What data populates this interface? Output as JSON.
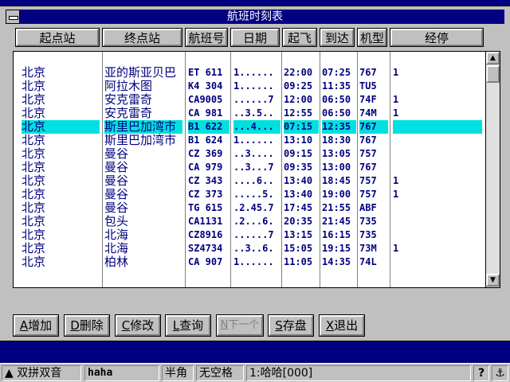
{
  "window": {
    "title": "航班时刻表"
  },
  "columns": [
    "起点站",
    "终点站",
    "航班号",
    "日期",
    "起飞",
    "到达",
    "机型",
    "经停"
  ],
  "rows": [
    {
      "from": "北京",
      "to": "亚的斯亚贝巴",
      "flight": "ET 611",
      "date": "1......",
      "dep": "22:00",
      "arr": "07:25",
      "type": "767",
      "stop": "1"
    },
    {
      "from": "北京",
      "to": "阿拉木图",
      "flight": "K4 304",
      "date": "1......",
      "dep": "09:25",
      "arr": "11:35",
      "type": "TU5",
      "stop": ""
    },
    {
      "from": "北京",
      "to": "安克雷奇",
      "flight": "CA9005",
      "date": "......7",
      "dep": "12:00",
      "arr": "06:50",
      "type": "74F",
      "stop": "1"
    },
    {
      "from": "北京",
      "to": "安克雷奇",
      "flight": "CA 981",
      "date": "..3.5..",
      "dep": "12:55",
      "arr": "06:50",
      "type": "74M",
      "stop": "1"
    },
    {
      "from": "北京",
      "to": "斯里巴加湾市",
      "flight": "B1 622",
      "date": "...4...",
      "dep": "07:15",
      "arr": "12:35",
      "type": "767",
      "stop": ""
    },
    {
      "from": "北京",
      "to": "斯里巴加湾市",
      "flight": "B1 624",
      "date": "1......",
      "dep": "13:10",
      "arr": "18:30",
      "type": "767",
      "stop": ""
    },
    {
      "from": "北京",
      "to": "曼谷",
      "flight": "CZ 369",
      "date": "..3....",
      "dep": "09:15",
      "arr": "13:05",
      "type": "757",
      "stop": ""
    },
    {
      "from": "北京",
      "to": "曼谷",
      "flight": "CA 979",
      "date": "..3...7",
      "dep": "09:35",
      "arr": "13:00",
      "type": "767",
      "stop": ""
    },
    {
      "from": "北京",
      "to": "曼谷",
      "flight": "CZ 343",
      "date": "....6..",
      "dep": "13:40",
      "arr": "18:45",
      "type": "757",
      "stop": "1"
    },
    {
      "from": "北京",
      "to": "曼谷",
      "flight": "CZ 373",
      "date": ".....5.",
      "dep": "13:40",
      "arr": "19:00",
      "type": "757",
      "stop": "1"
    },
    {
      "from": "北京",
      "to": "曼谷",
      "flight": "TG 615",
      "date": ".2.45.7",
      "dep": "17:45",
      "arr": "21:55",
      "type": "ABF",
      "stop": ""
    },
    {
      "from": "北京",
      "to": "包头",
      "flight": "CA1131",
      "date": ".2...6.",
      "dep": "20:35",
      "arr": "21:45",
      "type": "735",
      "stop": ""
    },
    {
      "from": "北京",
      "to": "北海",
      "flight": "CZ8916",
      "date": "......7",
      "dep": "13:15",
      "arr": "16:15",
      "type": "735",
      "stop": ""
    },
    {
      "from": "北京",
      "to": "北海",
      "flight": "SZ4734",
      "date": "..3..6.",
      "dep": "15:05",
      "arr": "19:15",
      "type": "73M",
      "stop": "1"
    },
    {
      "from": "北京",
      "to": "柏林",
      "flight": "CA 907",
      "date": "1......",
      "dep": "11:05",
      "arr": "14:35",
      "type": "74L",
      "stop": ""
    }
  ],
  "selected_row_index": 4,
  "buttons": [
    {
      "key": "A",
      "label": "增加",
      "enabled": true
    },
    {
      "key": "D",
      "label": "删除",
      "enabled": true
    },
    {
      "key": "C",
      "label": "修改",
      "enabled": true
    },
    {
      "key": "L",
      "label": "查询",
      "enabled": true
    },
    {
      "key": "N",
      "label": "下一个",
      "enabled": false
    },
    {
      "key": "S",
      "label": "存盘",
      "enabled": true
    },
    {
      "key": "X",
      "label": "退出",
      "enabled": true
    }
  ],
  "taskbar": {
    "ime_name": "双拼双音",
    "user": "haha",
    "width_mode": "半角",
    "space_mode": "无空格",
    "candidate": "1:哈哈[000]",
    "help": "?",
    "icons": [
      "up-arrow-icon",
      "help-icon",
      "anchor-icon"
    ]
  },
  "colors": {
    "window_bg": "#c0c0c0",
    "titlebar": "#000080",
    "desktop": "#000080",
    "text": "#000080",
    "highlight": "#00e0e0"
  }
}
